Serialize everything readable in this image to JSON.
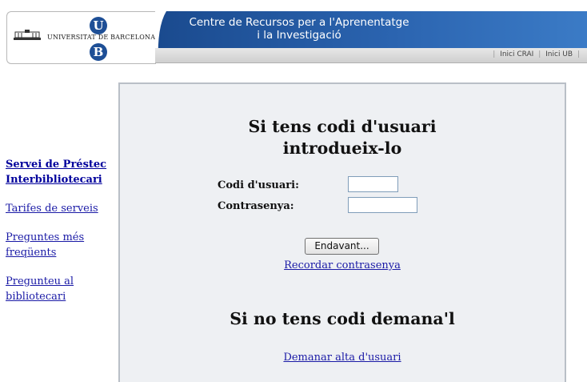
{
  "header": {
    "logo_text": "UNIVERSITAT DE BARCELONA",
    "logo_letters": [
      "U",
      "B"
    ],
    "title_line1": "Centre de Recursos per a l'Aprenentatge",
    "title_line2": "i la Investigació",
    "links": [
      "Inici CRAI",
      "Inici UB"
    ],
    "brand_color": "#1e4f96"
  },
  "sidebar": {
    "items": [
      {
        "label": "Servei de Préstec Interbibliotecari",
        "bold": true
      },
      {
        "label": "Tarifes de serveis",
        "bold": false
      },
      {
        "label": "Preguntes més freqüents",
        "bold": false
      },
      {
        "label": "Pregunteu al bibliotecari",
        "bold": false
      }
    ]
  },
  "login": {
    "heading_line1": "Si tens codi d'usuari",
    "heading_line2": "introdueix-lo",
    "user_label": "Codi d'usuari:",
    "pass_label": "Contrasenya:",
    "user_value": "",
    "pass_value": "",
    "submit_label": "Endavant...",
    "remember_link": "Recordar contrasenya"
  },
  "register": {
    "heading": "Si no tens codi demana'l",
    "link": "Demanar alta d'usuari"
  }
}
